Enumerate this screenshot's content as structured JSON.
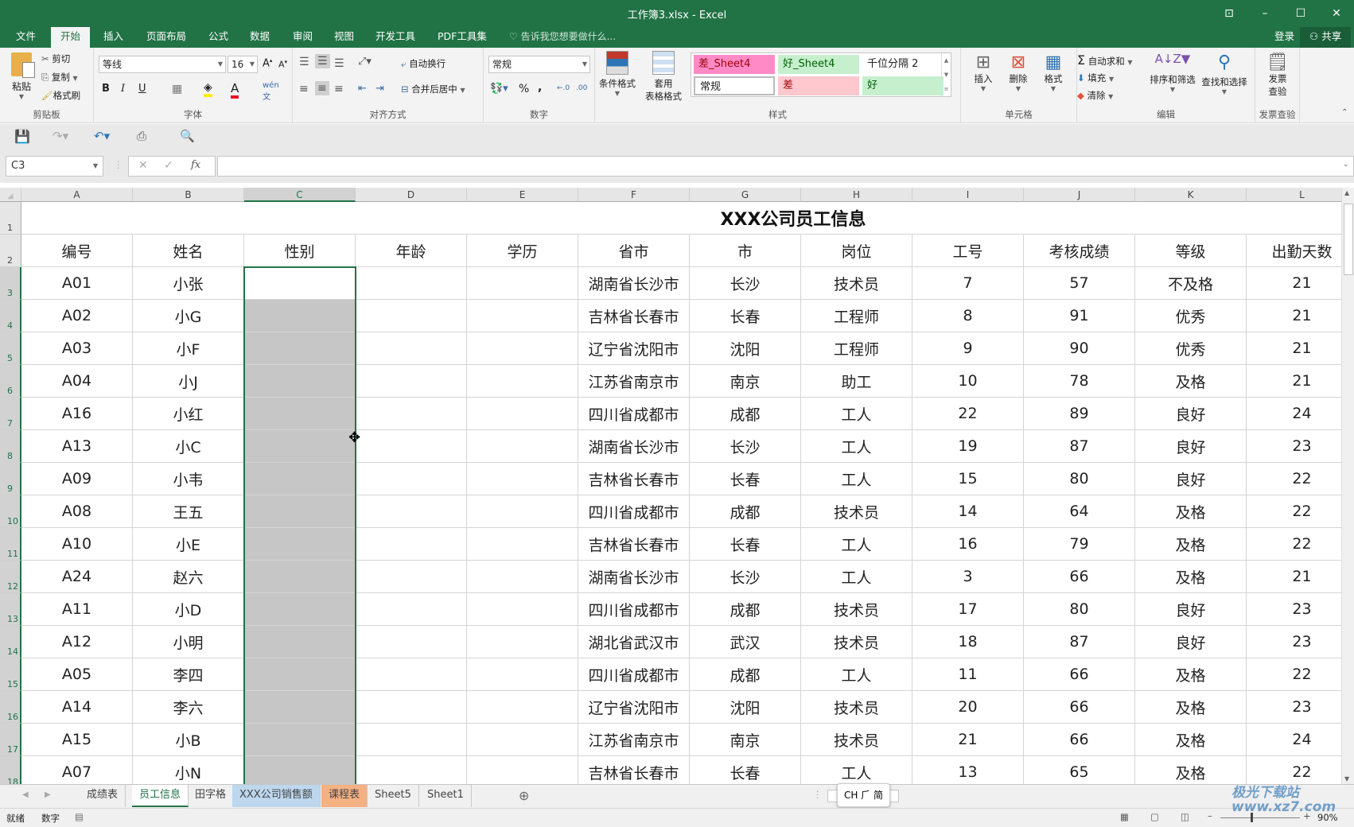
{
  "window": {
    "title": "工作簿3.xlsx - Excel",
    "controls": [
      "ribbon-display",
      "minimize",
      "maximize",
      "close"
    ],
    "sign_in": "登录",
    "share": "共享"
  },
  "menu_tabs": [
    {
      "label": "文件",
      "active": false
    },
    {
      "label": "开始",
      "active": true
    },
    {
      "label": "插入",
      "active": false
    },
    {
      "label": "页面布局",
      "active": false
    },
    {
      "label": "公式",
      "active": false
    },
    {
      "label": "数据",
      "active": false
    },
    {
      "label": "审阅",
      "active": false
    },
    {
      "label": "视图",
      "active": false
    },
    {
      "label": "开发工具",
      "active": false
    },
    {
      "label": "PDF工具集",
      "active": false
    }
  ],
  "tell_me": "告诉我您想要做什么...",
  "ribbon": {
    "clipboard": {
      "label": "剪贴板",
      "paste": "粘贴",
      "cut": "剪切",
      "copy": "复制",
      "format_painter": "格式刷"
    },
    "font": {
      "label": "字体",
      "font_name": "等线",
      "font_size": "16",
      "bold": "B",
      "italic": "I",
      "underline": "U",
      "font_color": "#e81123",
      "fill_color": "#ffeb00"
    },
    "alignment": {
      "label": "对齐方式",
      "wrap_text": "自动换行",
      "merge_center": "合并后居中"
    },
    "number": {
      "label": "数字",
      "format": "常规",
      "percent": "%",
      "comma": ","
    },
    "styles": {
      "label": "样式",
      "conditional_format": "条件格式",
      "format_as_table_1": "套用",
      "format_as_table_2": "表格格式",
      "gallery": [
        {
          "label": "差_Sheet4",
          "bg": "#ff8ac6",
          "fg": "#9c0006"
        },
        {
          "label": "好_Sheet4",
          "bg": "#c6efce",
          "fg": "#006100"
        },
        {
          "label": "千位分隔 2",
          "bg": "#ffffff",
          "fg": "#222222"
        },
        {
          "label": "常规",
          "bg": "#ffffff",
          "fg": "#222222"
        },
        {
          "label": "差",
          "bg": "#ffc7ce",
          "fg": "#9c0006"
        },
        {
          "label": "好",
          "bg": "#c6efce",
          "fg": "#006100"
        }
      ]
    },
    "cells": {
      "label": "单元格",
      "insert": "插入",
      "delete": "删除",
      "format": "格式"
    },
    "editing": {
      "label": "编辑",
      "autosum": "自动求和",
      "fill": "填充",
      "clear": "清除",
      "sort_filter": "排序和筛选",
      "find_select": "查找和选择"
    },
    "invoice": {
      "label": "发票查验",
      "btn1": "发票",
      "btn2": "查验"
    }
  },
  "formula_bar": {
    "name_box": "C3",
    "formula": "",
    "fx": "fx"
  },
  "sheet": {
    "columns": [
      "A",
      "B",
      "C",
      "D",
      "E",
      "F",
      "G",
      "H",
      "I",
      "J",
      "K",
      "L"
    ],
    "selected_column": "C",
    "title": "XXX公司员工信息",
    "headers": [
      "编号",
      "姓名",
      "性别",
      "年龄",
      "学历",
      "省市",
      "市",
      "岗位",
      "工号",
      "考核成绩",
      "等级",
      "出勤天数"
    ],
    "rows": [
      [
        "A01",
        "小张",
        "",
        "",
        "",
        "湖南省长沙市",
        "长沙",
        "技术员",
        "7",
        "57",
        "不及格",
        "21"
      ],
      [
        "A02",
        "小G",
        "",
        "",
        "",
        "吉林省长春市",
        "长春",
        "工程师",
        "8",
        "91",
        "优秀",
        "21"
      ],
      [
        "A03",
        "小F",
        "",
        "",
        "",
        "辽宁省沈阳市",
        "沈阳",
        "工程师",
        "9",
        "90",
        "优秀",
        "21"
      ],
      [
        "A04",
        "小J",
        "",
        "",
        "",
        "江苏省南京市",
        "南京",
        "助工",
        "10",
        "78",
        "及格",
        "21"
      ],
      [
        "A16",
        "小红",
        "",
        "",
        "",
        "四川省成都市",
        "成都",
        "工人",
        "22",
        "89",
        "良好",
        "24"
      ],
      [
        "A13",
        "小C",
        "",
        "",
        "",
        "湖南省长沙市",
        "长沙",
        "工人",
        "19",
        "87",
        "良好",
        "23"
      ],
      [
        "A09",
        "小韦",
        "",
        "",
        "",
        "吉林省长春市",
        "长春",
        "工人",
        "15",
        "80",
        "良好",
        "22"
      ],
      [
        "A08",
        "王五",
        "",
        "",
        "",
        "四川省成都市",
        "成都",
        "技术员",
        "14",
        "64",
        "及格",
        "22"
      ],
      [
        "A10",
        "小E",
        "",
        "",
        "",
        "吉林省长春市",
        "长春",
        "工人",
        "16",
        "79",
        "及格",
        "22"
      ],
      [
        "A24",
        "赵六",
        "",
        "",
        "",
        "湖南省长沙市",
        "长沙",
        "工人",
        "3",
        "66",
        "及格",
        "21"
      ],
      [
        "A11",
        "小D",
        "",
        "",
        "",
        "四川省成都市",
        "成都",
        "技术员",
        "17",
        "80",
        "良好",
        "23"
      ],
      [
        "A12",
        "小明",
        "",
        "",
        "",
        "湖北省武汉市",
        "武汉",
        "技术员",
        "18",
        "87",
        "良好",
        "23"
      ],
      [
        "A05",
        "李四",
        "",
        "",
        "",
        "四川省成都市",
        "成都",
        "工人",
        "11",
        "66",
        "及格",
        "22"
      ],
      [
        "A14",
        "李六",
        "",
        "",
        "",
        "辽宁省沈阳市",
        "沈阳",
        "技术员",
        "20",
        "66",
        "及格",
        "23"
      ],
      [
        "A15",
        "小B",
        "",
        "",
        "",
        "江苏省南京市",
        "南京",
        "技术员",
        "21",
        "66",
        "及格",
        "24"
      ],
      [
        "A07",
        "小N",
        "",
        "",
        "",
        "吉林省长春市",
        "长春",
        "工人",
        "13",
        "65",
        "及格",
        "22"
      ]
    ]
  },
  "sheet_tabs": [
    {
      "label": "成绩表",
      "active": false,
      "color": ""
    },
    {
      "label": "员工信息",
      "active": true,
      "color": ""
    },
    {
      "label": "田字格",
      "active": false,
      "color": ""
    },
    {
      "label": "XXX公司销售额",
      "active": false,
      "color": "#bdd7ee"
    },
    {
      "label": "课程表",
      "active": false,
      "color": "#f4b183"
    },
    {
      "label": "Sheet5",
      "active": false,
      "color": ""
    },
    {
      "label": "Sheet1",
      "active": false,
      "color": ""
    }
  ],
  "ime": "CH ⺁ 简",
  "status": {
    "ready": "就绪",
    "mode": "数字",
    "zoom": "90%"
  },
  "watermark": "极光下载站 www.xz7.com"
}
